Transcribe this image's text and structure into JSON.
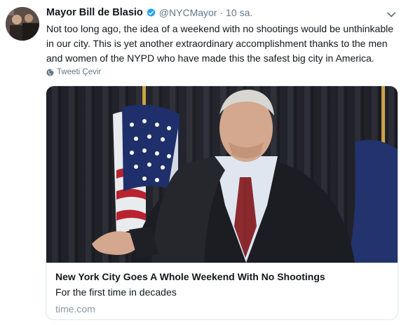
{
  "author": {
    "name": "Mayor Bill de Blasio",
    "handle": "@NYCMayor",
    "separator": "·",
    "time": "10 sa."
  },
  "tweet": {
    "text": "Not too long ago, the idea of a weekend with no shootings would be unthinkable in our city. This is yet another extraordinary accomplishment thanks to the men and women of the NYPD who have made this the safest big city in America.",
    "translate_label": "Tweeti Çevir"
  },
  "card": {
    "title": "New York City Goes A Whole Weekend With No Shootings",
    "description": "For the first time in decades",
    "domain": "time.com"
  },
  "colors": {
    "verified": "#1da1f2",
    "secondary_text": "#657786",
    "border": "#e1e8ed"
  },
  "icons": {
    "verified": "verified-badge-icon",
    "caret": "chevron-down-icon",
    "globe": "globe-icon"
  }
}
